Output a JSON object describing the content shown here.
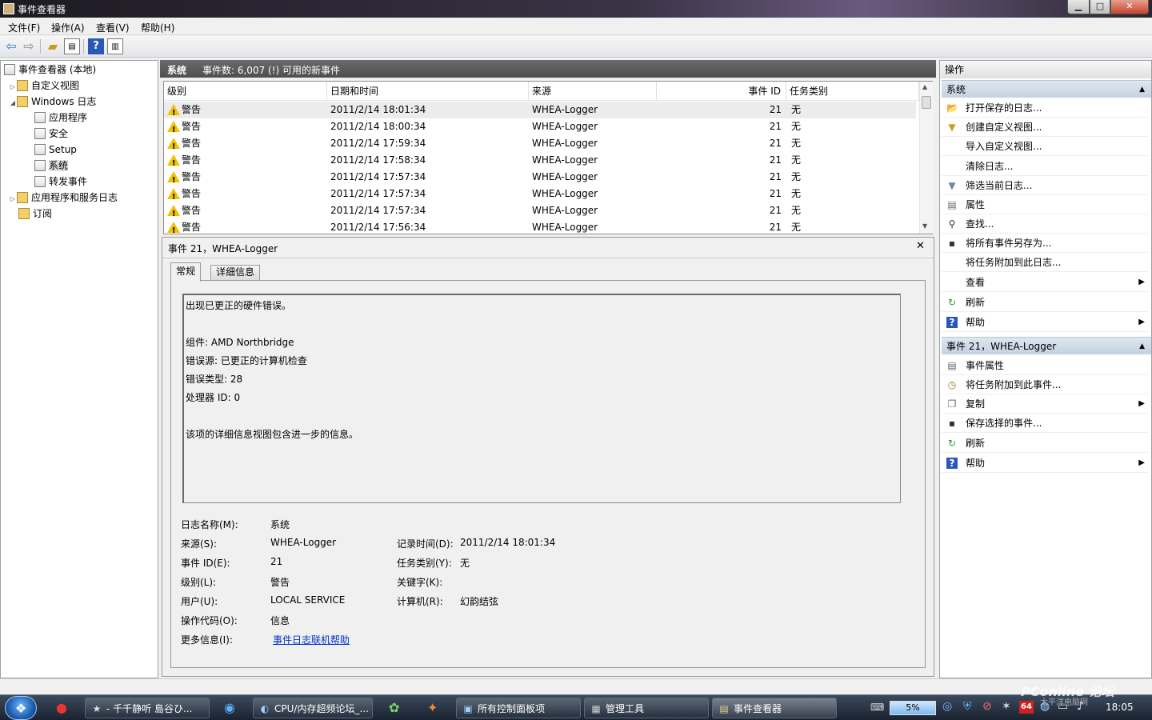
{
  "window": {
    "title": "事件查看器",
    "min": "▁",
    "max": "□",
    "close": "✕"
  },
  "menu": [
    "文件(F)",
    "操作(A)",
    "查看(V)",
    "帮助(H)"
  ],
  "toolbar": {
    "icons": [
      "back-icon",
      "forward-icon",
      "up-folder-icon",
      "show-hide-tree-icon",
      "help-icon",
      "show-hide-action-pane-icon"
    ]
  },
  "tree": {
    "root": "事件查看器 (本地)",
    "custom_views": "自定义视图",
    "windows_logs": "Windows 日志",
    "application": "应用程序",
    "security": "安全",
    "setup": "Setup",
    "system": "系统",
    "forwarded": "转发事件",
    "app_service_logs": "应用程序和服务日志",
    "subscriptions": "订阅"
  },
  "center": {
    "header_title": "系统",
    "header_count": "事件数: 6,007 (!) 可用的新事件",
    "columns": {
      "level": "级别",
      "datetime": "日期和时间",
      "source": "来源",
      "event_id": "事件 ID",
      "task": "任务类别"
    },
    "rows": [
      {
        "level": "警告",
        "datetime": "2011/2/14 18:01:34",
        "source": "WHEA-Logger",
        "event_id": "21",
        "task": "无"
      },
      {
        "level": "警告",
        "datetime": "2011/2/14 18:00:34",
        "source": "WHEA-Logger",
        "event_id": "21",
        "task": "无"
      },
      {
        "level": "警告",
        "datetime": "2011/2/14 17:59:34",
        "source": "WHEA-Logger",
        "event_id": "21",
        "task": "无"
      },
      {
        "level": "警告",
        "datetime": "2011/2/14 17:58:34",
        "source": "WHEA-Logger",
        "event_id": "21",
        "task": "无"
      },
      {
        "level": "警告",
        "datetime": "2011/2/14 17:57:34",
        "source": "WHEA-Logger",
        "event_id": "21",
        "task": "无"
      },
      {
        "level": "警告",
        "datetime": "2011/2/14 17:57:34",
        "source": "WHEA-Logger",
        "event_id": "21",
        "task": "无"
      },
      {
        "level": "警告",
        "datetime": "2011/2/14 17:57:34",
        "source": "WHEA-Logger",
        "event_id": "21",
        "task": "无"
      },
      {
        "level": "警告",
        "datetime": "2011/2/14 17:56:34",
        "source": "WHEA-Logger",
        "event_id": "21",
        "task": "无"
      }
    ]
  },
  "detail": {
    "title": "事件 21，WHEA-Logger",
    "close": "✕",
    "tab_general": "常规",
    "tab_details": "详细信息",
    "desc_lines": [
      "出现已更正的硬件错误。",
      "",
      "组件: AMD Northbridge",
      "错误源: 已更正的计算机检查",
      "错误类型: 28",
      "处理器 ID: 0",
      "",
      "该项的详细信息视图包含进一步的信息。"
    ],
    "labels": {
      "log_name": "日志名称(M):",
      "source": "来源(S):",
      "event_id": "事件 ID(E):",
      "level": "级别(L):",
      "user": "用户(U):",
      "opcode": "操作代码(O):",
      "more_info": "更多信息(I):",
      "logged": "记录时间(D):",
      "task": "任务类别(Y):",
      "keywords": "关键字(K):",
      "computer": "计算机(R):"
    },
    "values": {
      "log_name": "系统",
      "source": "WHEA-Logger",
      "event_id": "21",
      "level": "警告",
      "user": "LOCAL SERVICE",
      "opcode": "信息",
      "more_info": "事件日志联机帮助",
      "logged": "2011/2/14 18:01:34",
      "task": "无",
      "keywords": "",
      "computer": "幻韵结弦"
    }
  },
  "actions": {
    "header": "操作",
    "section1": "系统",
    "items1": [
      "打开保存的日志...",
      "创建自定义视图...",
      "导入自定义视图...",
      "清除日志...",
      "筛选当前日志...",
      "属性",
      "查找...",
      "将所有事件另存为...",
      "将任务附加到此日志...",
      "查看",
      "刷新",
      "帮助"
    ],
    "section2": "事件 21，WHEA-Logger",
    "items2": [
      "事件属性",
      "将任务附加到此事件...",
      "复制",
      "保存选择的事件...",
      "刷新",
      "帮助"
    ]
  },
  "taskbar": {
    "items": [
      "- 千千静听    島谷ひ...",
      "CPU/内存超频论坛_...",
      "所有控制面板项",
      "管理工具",
      "事件查看器"
    ],
    "cpu": "5%",
    "time": "18:05",
    "num": "64",
    "watermark": "PConline 论坛",
    "watermark_sub": "太平洋电脑网"
  }
}
